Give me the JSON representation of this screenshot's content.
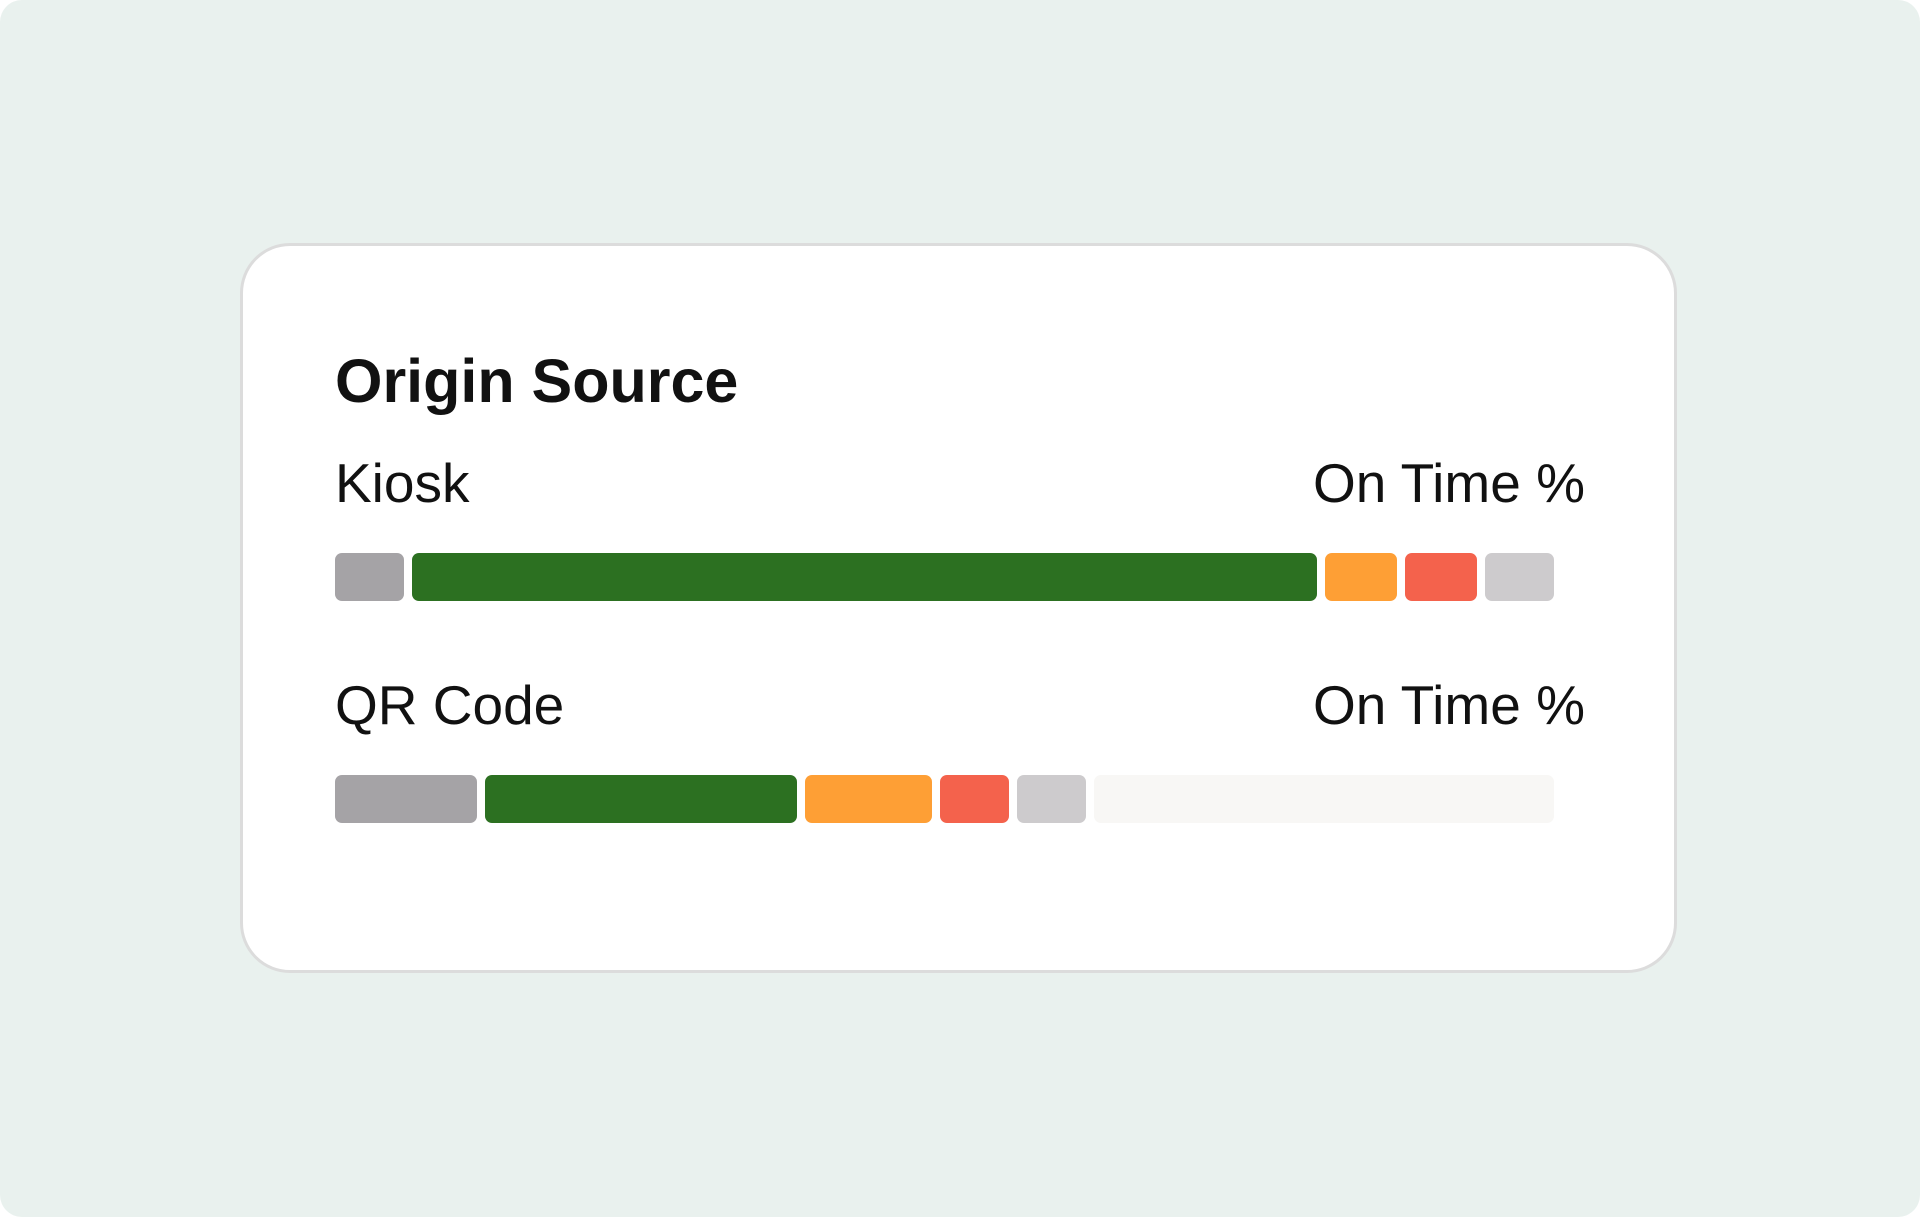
{
  "colors": {
    "backdrop": "#e9f1ee",
    "card": "#ffffff",
    "text": "#111111",
    "status_gray": "#a5a3a6",
    "status_green": "#2c7021",
    "status_orange": "#fe9f35",
    "status_red": "#f4624c",
    "status_light_gray": "#cdcbcd",
    "empty": "#f8f7f5"
  },
  "card": {
    "title": "Origin Source"
  },
  "rows": [
    {
      "label": "Kiosk",
      "metric_label": "On Time %",
      "segments": [
        {
          "status": "gray",
          "color": "#a5a3a6",
          "fraction": 0.0569
        },
        {
          "status": "green",
          "color": "#2c7021",
          "fraction": 0.7431
        },
        {
          "status": "orange",
          "color": "#fe9f35",
          "fraction": 0.0588
        },
        {
          "status": "red",
          "color": "#f4624c",
          "fraction": 0.0588
        },
        {
          "status": "light-gray",
          "color": "#cdcbcd",
          "fraction": 0.0569
        }
      ]
    },
    {
      "label": "QR Code",
      "metric_label": "On Time %",
      "segments": [
        {
          "status": "gray",
          "color": "#a5a3a6",
          "fraction": 0.1176
        },
        {
          "status": "green",
          "color": "#2c7021",
          "fraction": 0.2578
        },
        {
          "status": "orange",
          "color": "#fe9f35",
          "fraction": 0.1049
        },
        {
          "status": "red",
          "color": "#f4624c",
          "fraction": 0.0569
        },
        {
          "status": "light-gray",
          "color": "#cdcbcd",
          "fraction": 0.0569
        },
        {
          "status": "empty",
          "color": "#f8f7f5",
          "fraction": 0.3804
        }
      ]
    }
  ]
}
